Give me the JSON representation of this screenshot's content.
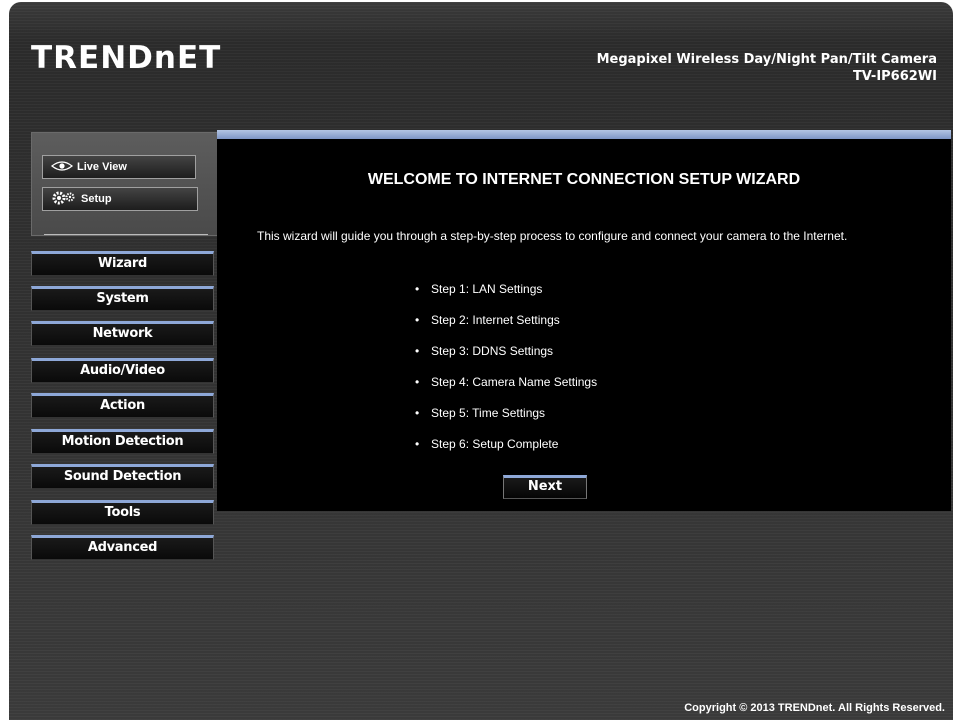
{
  "header": {
    "logo": "TRENDnET",
    "product_title": "Megapixel Wireless Day/Night Pan/Tilt Camera",
    "model": "TV-IP662WI"
  },
  "mode_buttons": {
    "live_view": {
      "label": "Live View",
      "icon": "eye-icon"
    },
    "setup": {
      "label": "Setup",
      "icon": "gear-icon"
    }
  },
  "nav": {
    "items": [
      {
        "label": "Wizard"
      },
      {
        "label": "System"
      },
      {
        "label": "Network"
      },
      {
        "label": "Audio/Video"
      },
      {
        "label": "Action"
      },
      {
        "label": "Motion Detection"
      },
      {
        "label": "Sound Detection"
      },
      {
        "label": "Tools"
      },
      {
        "label": "Advanced"
      }
    ]
  },
  "main": {
    "title": "WELCOME TO INTERNET CONNECTION SETUP WIZARD",
    "intro": "This wizard will guide you through a step-by-step process to configure and connect your camera to the Internet.",
    "steps": [
      "Step 1: LAN Settings",
      "Step 2: Internet Settings",
      "Step 3: DDNS Settings",
      "Step 4: Camera Name Settings",
      "Step 5: Time Settings",
      "Step 6: Setup Complete"
    ],
    "next_label": "Next"
  },
  "footer": {
    "copyright": "Copyright © 2013 TRENDnet. All Rights Reserved."
  },
  "colors": {
    "accent_blue": "#8ea8d8",
    "panel_bg": "#000000",
    "frame_bg": "#333333"
  }
}
